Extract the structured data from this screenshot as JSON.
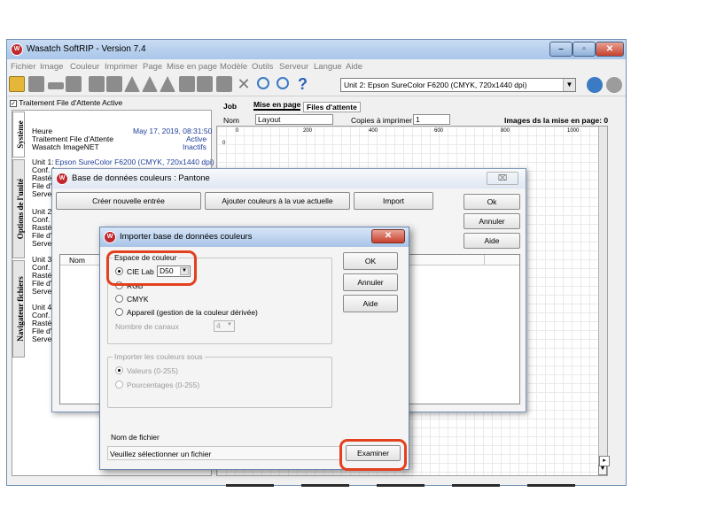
{
  "window": {
    "title": "Wasatch SoftRIP - Version 7.4",
    "app_logo_text": "W"
  },
  "menu": [
    "Fichier",
    "Image",
    "Couleur",
    "Imprimer",
    "Page",
    "Mise en page",
    "Modèle",
    "Outils",
    "Serveur",
    "Langue",
    "Aide"
  ],
  "toolbar": {
    "device_select": "Unit 2: Epson  SureColor F6200  (CMYK, 720x1440 dpi)",
    "help_glyph": "?"
  },
  "left_panel": {
    "queue_checkbox_label": "Traitement File d'Attente Active",
    "heure_label": "Heure",
    "heure_value": "May 17, 2019,  08:31:50",
    "traitement_label": "Traitement File d'Attente",
    "traitement_value": "Active",
    "imagenet_label": "Wasatch ImageNET",
    "imagenet_value": "Inactifs",
    "unit1_label": "Unit 1:",
    "unit1_value": "Epson  SureColor F6200  (CMYK, 720x1440 dpi)",
    "unit1_lines": [
      "Conf. fo",
      "Rastéri",
      "File d'At",
      "Serveur"
    ],
    "unit2_label": "Unit 2:",
    "unit2_lines": [
      "Conf. fo",
      "Rastéri",
      "File d'At",
      "Serveu"
    ],
    "unit3_label": "Unit 3:",
    "unit3_lines": [
      "Conf. fo",
      "Rastéri",
      "File d'At",
      "Serveu"
    ],
    "unit4_label": "Unit 4:",
    "unit4_lines": [
      "Conf. fo",
      "Rastéri",
      "File d'At",
      "Serveu"
    ],
    "vtabs": [
      "Système",
      "Options de l'unité",
      "Navigateur fichiers"
    ]
  },
  "right_panel": {
    "tab_job": "Job",
    "tab_mise": "Mise en page",
    "tab_files": "Files d'attente",
    "nom_label": "Nom",
    "nom_value": "Layout",
    "copies_label": "Copies à imprimer",
    "copies_value": "1",
    "images_label": "Images ds la mise en page: 0",
    "ruler_ticks": [
      "0",
      "200",
      "400",
      "600",
      "800",
      "1000"
    ],
    "ruler_left_tick": "0"
  },
  "dialog_db": {
    "title": "Base de données couleurs : Pantone",
    "btn_create": "Créer nouvelle entrée",
    "btn_add": "Ajouter couleurs à la vue actuelle",
    "btn_import": "Import",
    "btn_ok": "Ok",
    "btn_cancel": "Annuler",
    "btn_help": "Aide",
    "col_nom": "Nom",
    "close_glyph": "⌧"
  },
  "dialog_import": {
    "title": "Importer base de données couleurs",
    "group_space": "Espace de couleur",
    "opt_cielab": "CIE Lab",
    "cielab_select": "D50",
    "opt_rgb": "RGB",
    "opt_cmyk": "CMYK",
    "opt_device": "Appareil (gestion de la couleur dérivée)",
    "channels_label": "Nombre de canaux",
    "channels_value": "4",
    "group_import": "Importer les couleurs sous",
    "opt_values": "Valeurs (0-255)",
    "opt_percent": "Pourcentages (0-255)",
    "btn_ok": "OK",
    "btn_cancel": "Annuler",
    "btn_help": "Aide",
    "filename_label": "Nom de fichier",
    "filename_value": "Veuillez sélectionner un fichier",
    "btn_browse": "Examiner",
    "close_glyph": "✕"
  },
  "colors": {
    "highlight": "#e2401f",
    "title_blue": "#a9c6ea",
    "close_red": "#c7412c"
  }
}
